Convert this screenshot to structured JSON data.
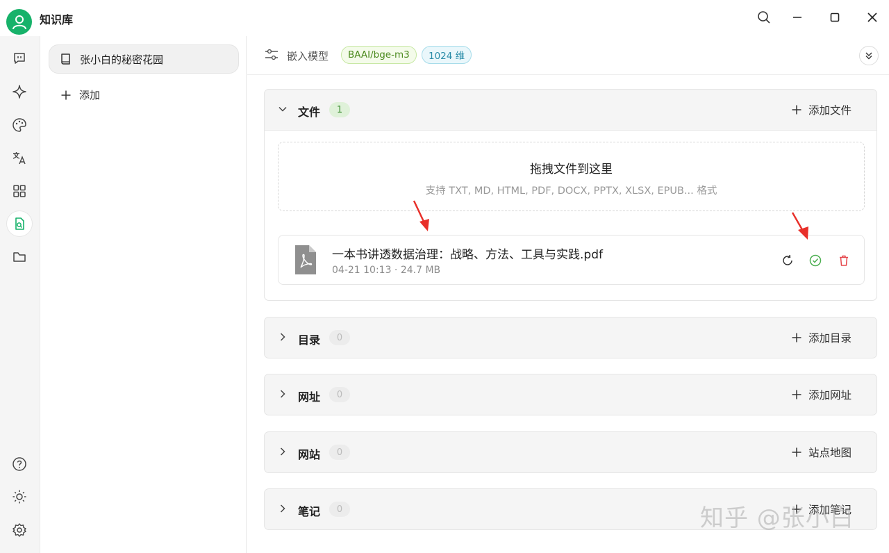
{
  "app": {
    "title": "知识库",
    "accent": "#17b26a"
  },
  "window": {
    "search_icon": "search-icon",
    "minimize_icon": "minimize-icon",
    "maximize_icon": "maximize-icon",
    "close_icon": "close-icon"
  },
  "rail": {
    "items": [
      {
        "icon": "chat-icon"
      },
      {
        "icon": "sparkle-icon"
      },
      {
        "icon": "palette-icon"
      },
      {
        "icon": "translate-icon"
      },
      {
        "icon": "apps-icon"
      },
      {
        "icon": "knowledge-base-icon",
        "active": true
      },
      {
        "icon": "folder-icon"
      }
    ],
    "bottom": [
      {
        "icon": "help-icon"
      },
      {
        "icon": "theme-icon"
      },
      {
        "icon": "settings-icon"
      }
    ]
  },
  "kb_list": {
    "items": [
      {
        "label": "张小白的秘密花园",
        "icon": "book-icon"
      }
    ],
    "add_label": "添加"
  },
  "toolbar": {
    "label": "嵌入模型",
    "model_tag": "BAAI/bge-m3",
    "dim_tag": "1024 维"
  },
  "sections": {
    "files": {
      "title": "文件",
      "count": "1",
      "action": "添加文件",
      "expanded": true,
      "dropzone": {
        "title": "拖拽文件到这里",
        "subtitle": "支持 TXT, MD, HTML, PDF, DOCX, PPTX, XLSX, EPUB... 格式"
      },
      "items": [
        {
          "name": "一本书讲透数据治理：战略、方法、工具与实践.pdf",
          "meta": "04-21 10:13 · 24.7 MB",
          "status": "done"
        }
      ]
    },
    "dirs": {
      "title": "目录",
      "count": "0",
      "action": "添加目录"
    },
    "urls": {
      "title": "网址",
      "count": "0",
      "action": "添加网址"
    },
    "sites": {
      "title": "网站",
      "count": "0",
      "action": "站点地图"
    },
    "notes": {
      "title": "笔记",
      "count": "0",
      "action": "添加笔记"
    }
  },
  "watermark": "知乎 @张小白"
}
